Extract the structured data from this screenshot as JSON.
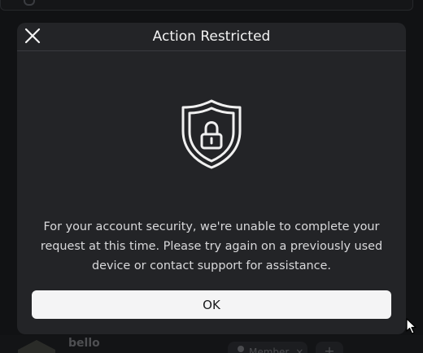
{
  "background": {
    "member_name": "bello",
    "member_badge_label": "Member",
    "badge_remove_glyph": "×",
    "add_glyph": "+"
  },
  "dialog": {
    "title": "Action Restricted",
    "close_icon": "close-icon",
    "illustration_icon": "shield-lock-icon",
    "message": "For your account security, we're unable to complete your request at this time. Please try again on a previously used device or contact support for assistance.",
    "ok_label": "OK"
  },
  "colors": {
    "backdrop": "#111214",
    "dialog_background": "#232427",
    "divider": "#3a3b3f",
    "title_text": "#f2f2f2",
    "message_text": "#d9d9db",
    "primary_button_bg": "#f4f4f5",
    "primary_button_text": "#18191b"
  }
}
